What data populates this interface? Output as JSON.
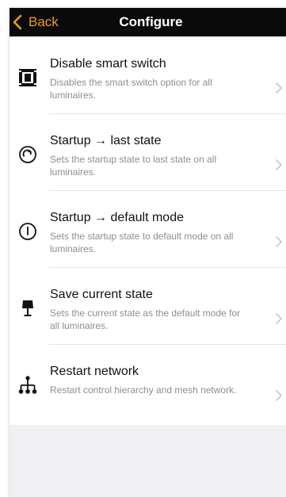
{
  "nav": {
    "back_label": "Back",
    "title": "Configure",
    "accent_color": "#f39b1c",
    "bar_color": "#0a0a0a"
  },
  "items": [
    {
      "title": "Disable smart switch",
      "subtitle": "Disables the smart switch option for all luminaires.",
      "icon": "smart-switch-icon"
    },
    {
      "title": "Startup → last state",
      "subtitle": "Sets the startup state to last state on all luminaires.",
      "icon": "restore-last-state-icon"
    },
    {
      "title": "Startup → default mode",
      "subtitle": "Sets the startup state to default mode on all luminaires.",
      "icon": "power-icon"
    },
    {
      "title": "Save current state",
      "subtitle": "Sets the current state as the default mode for all luminaires.",
      "icon": "lamp-icon"
    },
    {
      "title": "Restart network",
      "subtitle": "Restart control hierarchy and mesh network.",
      "icon": "network-hierarchy-icon"
    }
  ]
}
